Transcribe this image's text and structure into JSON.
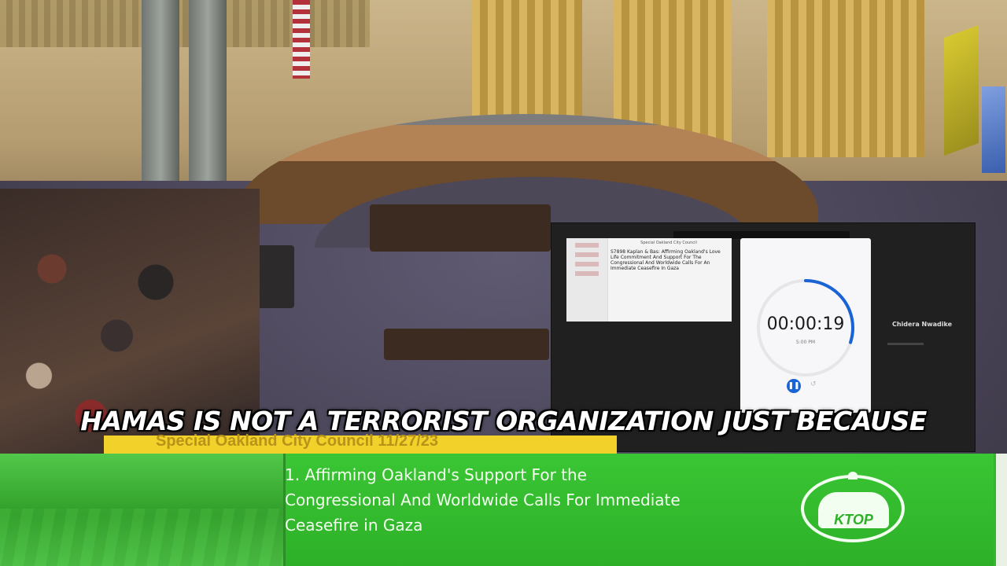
{
  "caption": {
    "text": "HAMAS IS NOT A TERRORIST ORGANIZATION JUST BECAUSE"
  },
  "meeting_banner": {
    "text": "Special Oakland City Council  11/27/23",
    "color": "#f1d12a"
  },
  "agenda_item": {
    "line1": "1. Affirming Oakland's Support For the",
    "line2": "Congressional And Worldwide Calls For Immediate",
    "line3": "Ceasefire in Gaza",
    "background_color": "#37b52f"
  },
  "station_logo": {
    "text": "KTOP"
  },
  "zoom_overlay": {
    "document_header": "Special Oakland City Council",
    "document_text": "S7898 Kaplan & Bas: Affirming Oakland's Love Life Commitment And Support For The Congressional And Worldwide Calls For An Immediate Ceasefire In Gaza",
    "timer": {
      "time": "00:00:19",
      "sub_label": "5:00 PM",
      "progress": 0.3,
      "accent_color": "#1a63d6"
    },
    "participant_name": "Chidera Nwadike"
  }
}
